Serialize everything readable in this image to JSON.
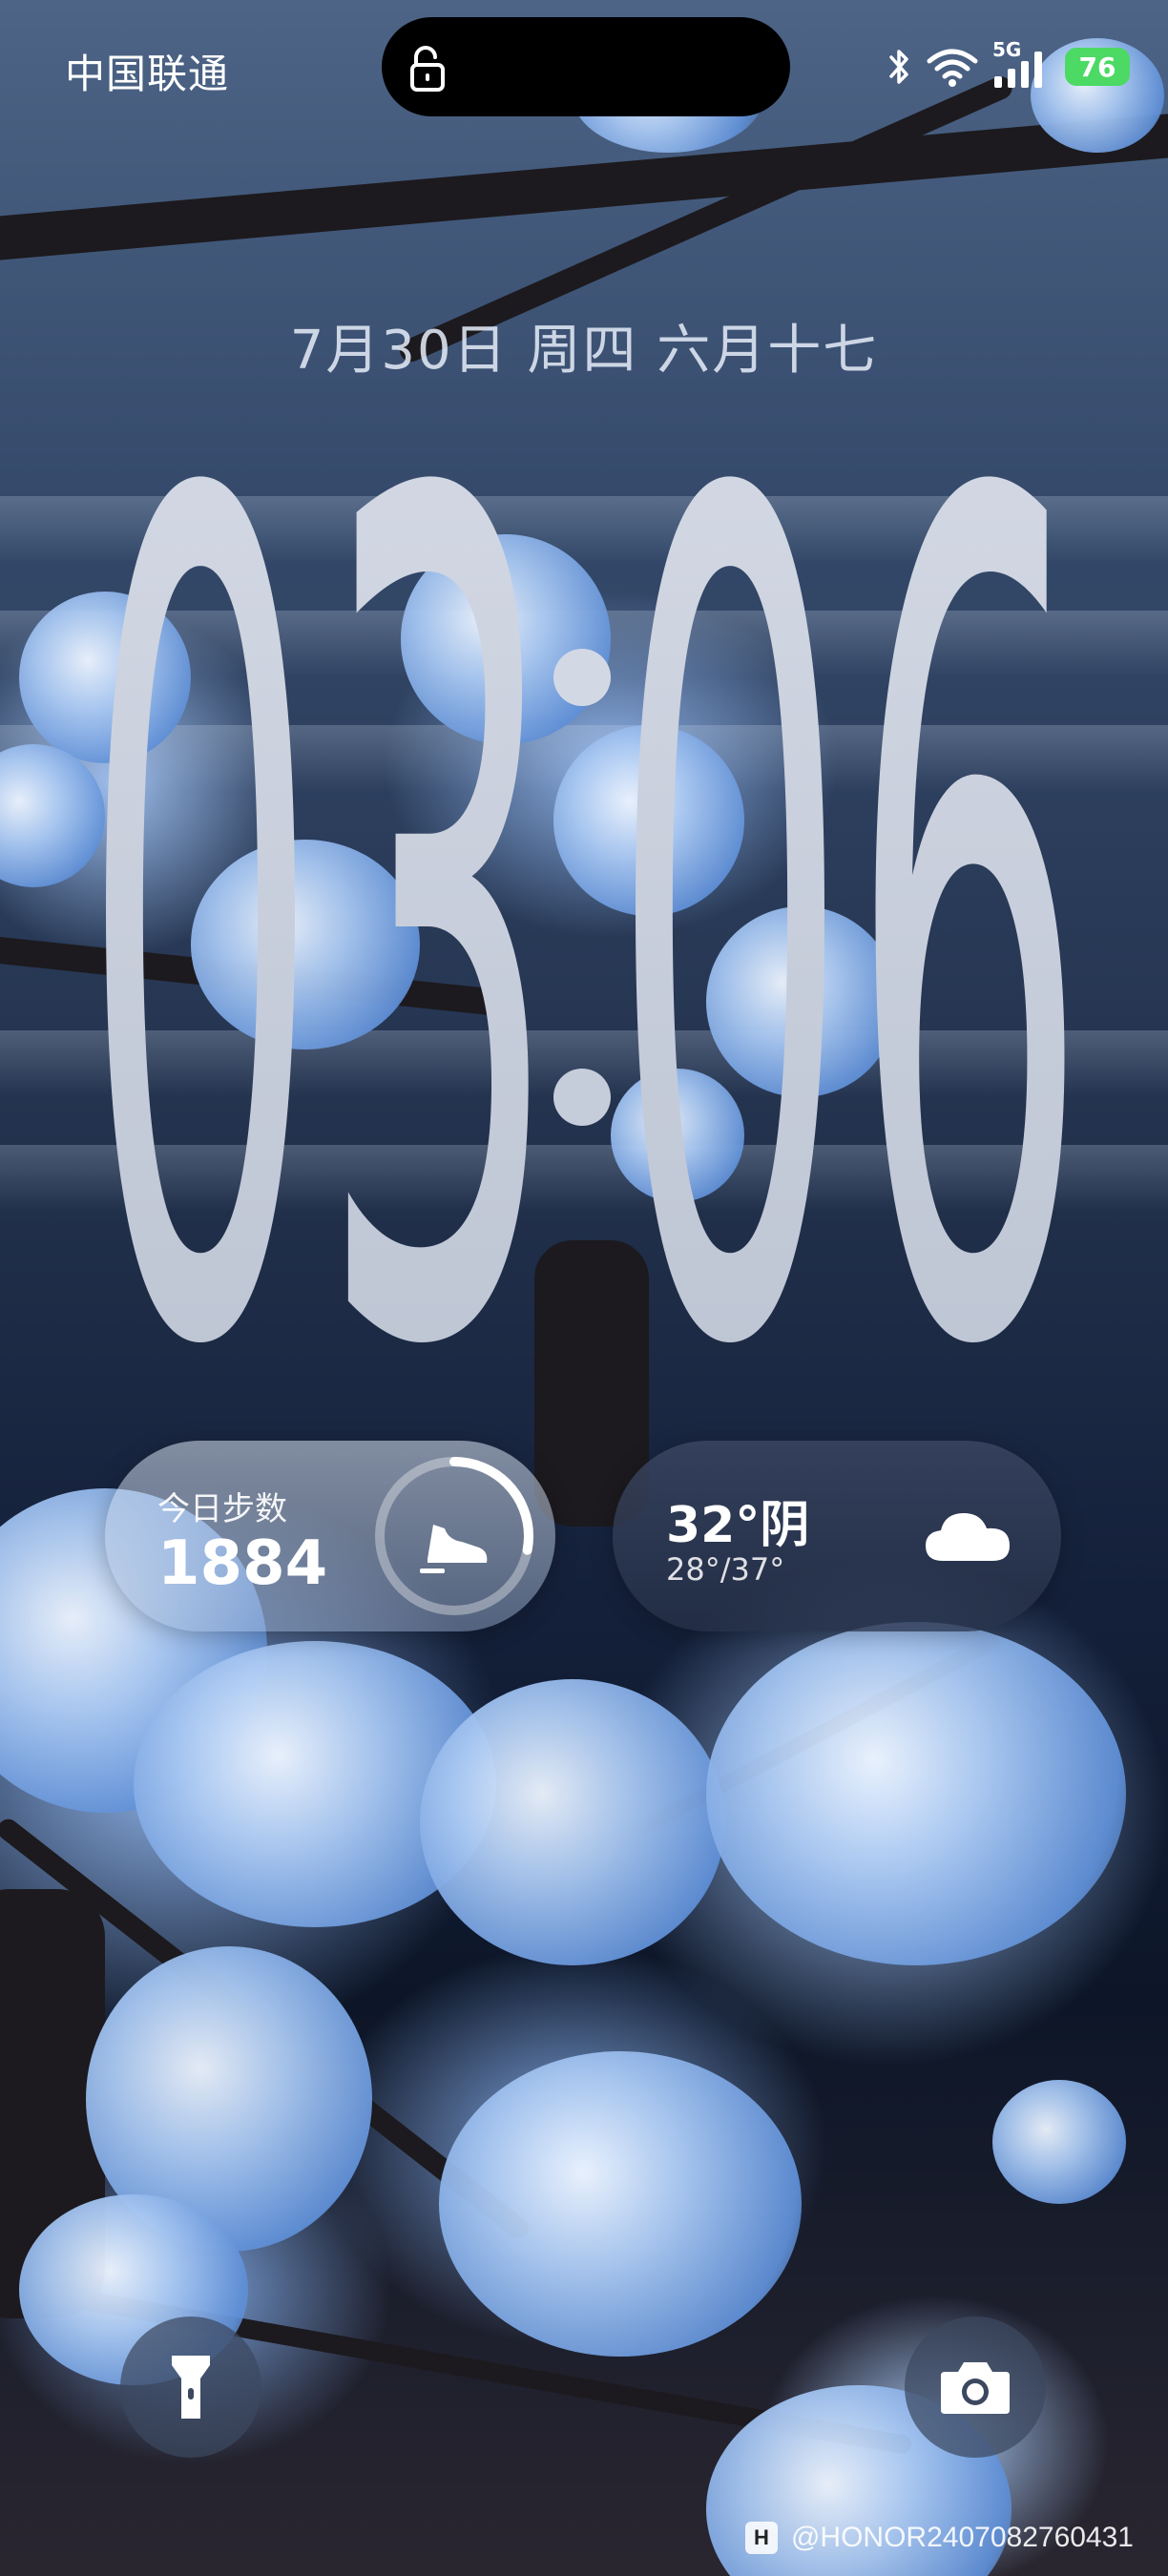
{
  "status_bar": {
    "carrier": "中国联通",
    "network_label": "5G",
    "battery_level": "76",
    "icons": [
      "lock-open-icon",
      "bluetooth-icon",
      "wifi-icon",
      "signal-icon",
      "battery-icon"
    ]
  },
  "lock_screen": {
    "date_text": "7月30日 周四 六月十七",
    "clock": {
      "hours": "03",
      "minutes": "06"
    }
  },
  "widgets": {
    "steps": {
      "label": "今日步数",
      "value": "1884",
      "progress_fraction": 0.28,
      "icon": "shoe-icon"
    },
    "weather": {
      "temperature_condition": "32°阴",
      "range": "28°/37°",
      "icon": "cloud-icon"
    }
  },
  "shortcuts": {
    "left": "flashlight-icon",
    "right": "camera-icon"
  },
  "watermark": {
    "logo_letter": "H",
    "text": "@HONOR2407082760431"
  },
  "colors": {
    "battery": "#4cd964",
    "clock_digits": "#c9d0dd"
  }
}
